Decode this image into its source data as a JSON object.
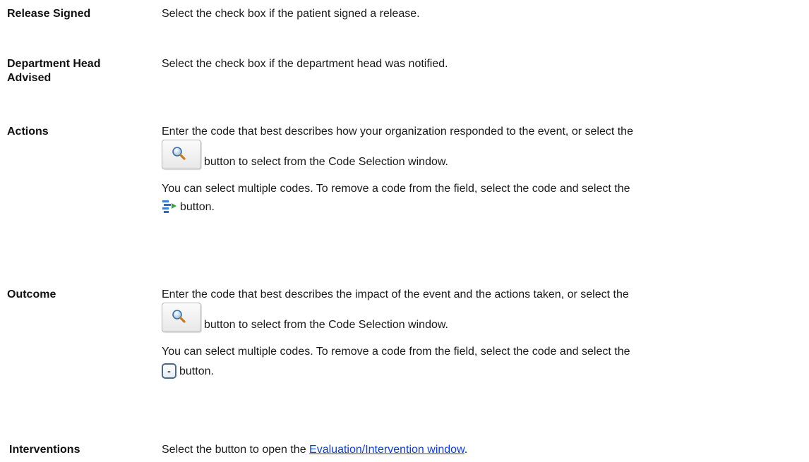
{
  "rows": {
    "release_signed": {
      "term": "Release Signed",
      "desc": "Select the check box if the patient signed a release."
    },
    "department_head": {
      "term_line1": "Department Head",
      "term_line2": "Advised",
      "desc": "Select the check box if the department head was notified."
    },
    "actions": {
      "term": "Actions",
      "p1_line1": "Enter the code that best describes how your organization responded to the event, or select the",
      "p1_line2": "button to select from the Code Selection window.",
      "p2_line1": "You can select multiple codes. To remove a code from the field, select the code and select the",
      "p2_line2": "button."
    },
    "outcome": {
      "term": "Outcome",
      "p1_line1": "Enter the code that best describes the impact of the event and the actions taken, or select the",
      "p1_line2": "button to select from the Code Selection window.",
      "p2_line1": "You can select multiple codes. To remove a code from the field, select the code and select the",
      "p2_line2": "button.",
      "remove_button_glyph": "-"
    },
    "interventions": {
      "term": "Interventions",
      "desc_prefix": "Select the button to open the ",
      "link_text": "Evaluation/Intervention window",
      "desc_suffix": "."
    }
  },
  "colors": {
    "link": "#0b3fd4",
    "text": "#1a1a1a"
  },
  "icons": {
    "search": "magnifier-icon",
    "remove_from_list": "remove-from-list-icon",
    "remove": "minus-icon"
  }
}
